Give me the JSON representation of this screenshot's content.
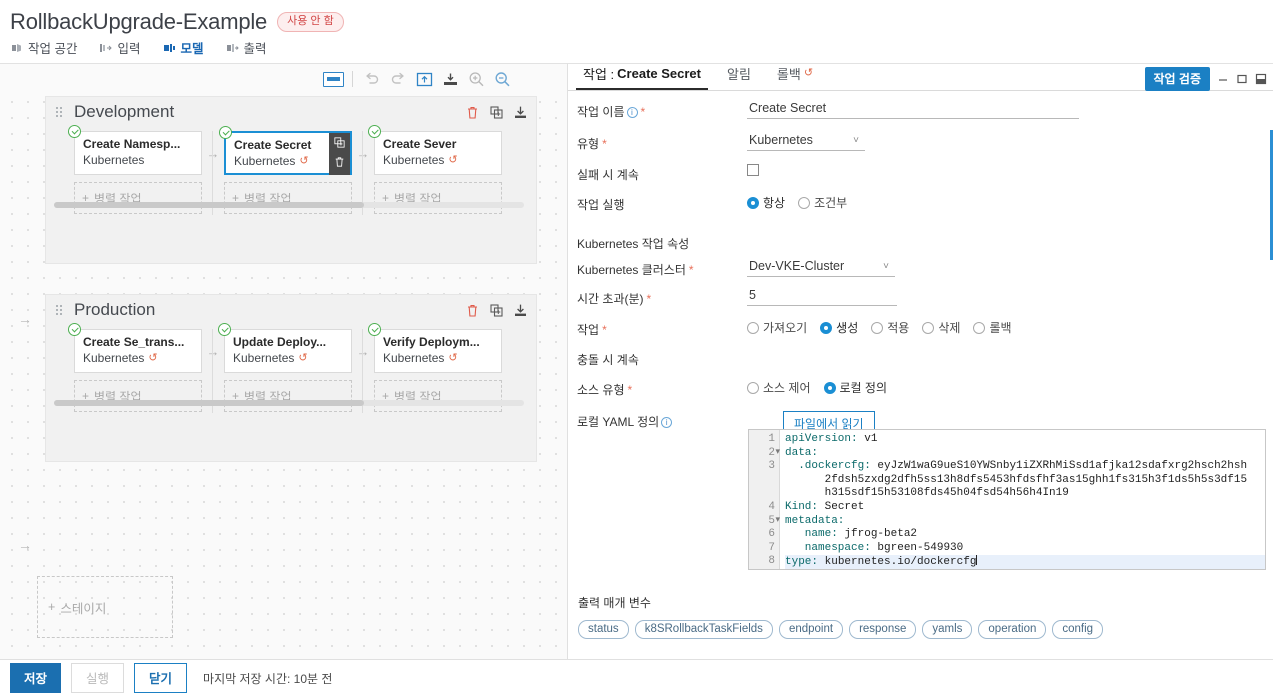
{
  "header": {
    "pipeline_title": "RollbackUpgrade-Example",
    "status_badge": "사용 안 함",
    "tabs": [
      {
        "label": "작업 공간",
        "icon": "workspace-icon",
        "active": false
      },
      {
        "label": "입력",
        "icon": "input-icon",
        "active": false
      },
      {
        "label": "모델",
        "icon": "model-icon",
        "active": true
      },
      {
        "label": "출력",
        "icon": "output-icon",
        "active": false
      }
    ]
  },
  "canvas": {
    "toolbar": [
      {
        "name": "keyboard-shortcuts-icon",
        "label": ""
      },
      {
        "name": "undo-icon",
        "label": ""
      },
      {
        "name": "redo-icon",
        "label": ""
      },
      {
        "name": "collapse-all-icon",
        "label": ""
      },
      {
        "name": "expand-all-icon",
        "label": ""
      },
      {
        "name": "zoom-in-icon",
        "label": ""
      },
      {
        "name": "zoom-out-icon",
        "label": ""
      }
    ],
    "stages": [
      {
        "name": "Development",
        "tasks": [
          {
            "title": "Create Namesp...",
            "subtitle": "Kubernetes",
            "rollback": false,
            "selected": false,
            "status": "ok"
          },
          {
            "title": "Create Secret",
            "subtitle": "Kubernetes",
            "rollback": true,
            "selected": true,
            "status": "ok"
          },
          {
            "title": "Create Sever",
            "subtitle": "Kubernetes",
            "rollback": true,
            "selected": false,
            "status": "ok"
          }
        ],
        "parallel_label": "병렬 작업"
      },
      {
        "name": "Production",
        "tasks": [
          {
            "title": "Create Se_trans...",
            "subtitle": "Kubernetes",
            "rollback": true,
            "selected": false,
            "status": "ok"
          },
          {
            "title": "Update Deploy...",
            "subtitle": "Kubernetes",
            "rollback": true,
            "selected": false,
            "status": "ok"
          },
          {
            "title": "Verify Deploym...",
            "subtitle": "Kubernetes",
            "rollback": true,
            "selected": false,
            "status": "ok"
          }
        ],
        "parallel_label": "병렬 작업"
      }
    ],
    "add_stage_label": "스테이지"
  },
  "panel": {
    "tabs": [
      {
        "label": "작업 :",
        "value": "Create Secret",
        "active": true
      },
      {
        "label": "알림",
        "value": "",
        "active": false
      },
      {
        "label": "롤백",
        "value": "",
        "active": false,
        "rollback_icon": true
      }
    ],
    "validate_button": "작업 검증",
    "window_controls": [
      "minimize-icon",
      "maximize-icon",
      "dock-icon"
    ],
    "fields": {
      "task_name_label": "작업 이름",
      "task_name_value": "Create Secret",
      "type_label": "유형",
      "type_value": "Kubernetes",
      "continue_on_fail_label": "실패 시 계속",
      "continue_on_fail_checked": false,
      "task_run_label": "작업 실행",
      "task_run_options": [
        "항상",
        "조건부"
      ],
      "task_run_selected": "항상",
      "k8s_section_title": "Kubernetes 작업 속성",
      "cluster_label": "Kubernetes 클러스터",
      "cluster_value": "Dev-VKE-Cluster",
      "timeout_label": "시간 초과(분)",
      "timeout_value": "5",
      "action_label": "작업",
      "action_options": [
        "가져오기",
        "생성",
        "적용",
        "삭제",
        "롤백"
      ],
      "action_selected": "생성",
      "continue_on_conflict_label": "충돌 시 계속",
      "continue_on_conflict_on": true,
      "source_type_label": "소스 유형",
      "source_type_options": [
        "소스 제어",
        "로컬 정의"
      ],
      "source_type_selected": "로컬 정의",
      "local_yaml_label": "로컬 YAML 정의",
      "read_from_file_button": "파일에서 읽기"
    },
    "yaml": {
      "lines": [
        {
          "n": "1",
          "fold": false,
          "key": "apiVersion:",
          "rest": " v1",
          "indent": 0
        },
        {
          "n": "2",
          "fold": true,
          "key": "data:",
          "rest": "",
          "indent": 0
        },
        {
          "n": "3",
          "fold": false,
          "key": "  .dockercfg:",
          "rest": " eyJzW1waG9ueS10YWSnby1iZXRhMiSsd1afjka12sdafxrg2hsch2hsh",
          "indent": 1
        },
        {
          "n": "",
          "fold": false,
          "key": "",
          "rest": "      2fdsh5zxdg2dfh5ss13h8dfs5453hfdsfhf3as15ghh1fs315h3f1ds5h5s3df15",
          "indent": 2
        },
        {
          "n": "",
          "fold": false,
          "key": "",
          "rest": "      h315sdf15h53108fds45h04fsd54h56h4In19",
          "indent": 2
        },
        {
          "n": "4",
          "fold": false,
          "key": "Kind:",
          "rest": " Secret",
          "indent": 0
        },
        {
          "n": "5",
          "fold": true,
          "key": "metadata:",
          "rest": "",
          "indent": 0
        },
        {
          "n": "6",
          "fold": false,
          "key": "   name:",
          "rest": " jfrog-beta2",
          "indent": 1
        },
        {
          "n": "7",
          "fold": false,
          "key": "   namespace:",
          "rest": " bgreen-549930",
          "indent": 1
        },
        {
          "n": "8",
          "fold": false,
          "key": "type:",
          "rest": " kubernetes.io/dockercfg",
          "indent": 0,
          "highlight": true
        }
      ]
    },
    "output_params_title": "출력 매개 변수",
    "output_params": [
      "status",
      "k8SRollbackTaskFields",
      "endpoint",
      "response",
      "yamls",
      "operation",
      "config"
    ]
  },
  "footer": {
    "save_label": "저장",
    "run_label": "실행",
    "close_label": "닫기",
    "last_saved": "마지막 저장 시간: 10분 전"
  },
  "colors": {
    "accent": "#1b80c4",
    "primary": "#1b6fb0",
    "danger": "#d14545",
    "rollback": "#e06a4a",
    "success": "#4caf50"
  }
}
